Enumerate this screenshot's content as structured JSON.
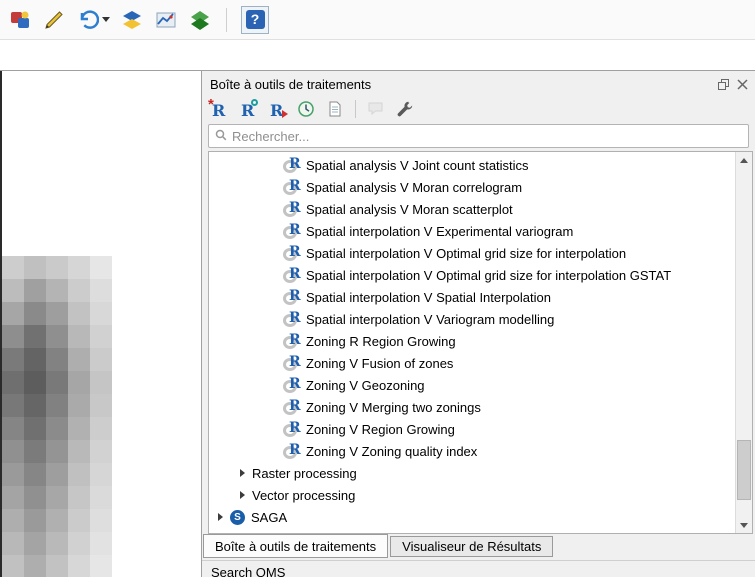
{
  "main_toolbar": {
    "icons": [
      "processing-icon",
      "pen-digitize-icon",
      "undo-icon",
      "undo-dropdown-arrow-icon",
      "saga-layers-icon",
      "profile-map-icon",
      "grass-icon",
      "help-icon"
    ]
  },
  "panel": {
    "title": "Boîte à outils de traitements",
    "titlebar_icons": [
      "float-panel-icon",
      "close-panel-icon"
    ],
    "toolbar_icons": [
      "new-r-script-icon",
      "open-r-script-icon",
      "save-r-script-icon",
      "history-icon",
      "log-icon",
      "comment-icon",
      "options-icon"
    ],
    "search": {
      "placeholder": "Rechercher...",
      "icon": "search-icon",
      "value": ""
    },
    "tree": {
      "script_icon": "r-logo-icon",
      "scripts": [
        "Spatial analysis V Joint count statistics",
        "Spatial analysis V Moran correlogram",
        "Spatial analysis V Moran scatterplot",
        "Spatial interpolation V Experimental variogram",
        "Spatial interpolation V Optimal grid size for interpolation",
        "Spatial interpolation V Optimal grid size for interpolation GSTAT",
        "Spatial interpolation V Spatial Interpolation",
        "Spatial interpolation V Variogram modelling",
        "Zoning R Region Growing",
        "Zoning V Fusion of zones",
        "Zoning V Geozoning",
        "Zoning V Merging two zonings",
        "Zoning V Region Growing",
        "Zoning V Zoning quality index"
      ],
      "groups": [
        {
          "label": "Raster processing",
          "depth": 1,
          "icon": ""
        },
        {
          "label": "Vector processing",
          "depth": 1,
          "icon": ""
        },
        {
          "label": "SAGA",
          "depth": 0,
          "icon": "saga"
        }
      ]
    },
    "tabs": [
      {
        "label": "Boîte à outils de traitements",
        "active": true
      },
      {
        "label": "Visualiseur de Résultats",
        "active": false
      }
    ]
  },
  "bottom_panel": {
    "title": "Search QMS"
  },
  "colors": {
    "accent_blue": "#1d5fae",
    "panel_bg": "#f0f0f0",
    "saga_blue": "#1a5da8",
    "r_ring_gray": "#c3c3c3"
  },
  "map_preview": {
    "pixels": [
      [
        "#cdcdcd",
        "#c0c0c0",
        "#cacaca",
        "#d6d6d6",
        "#e6e6e6"
      ],
      [
        "#bcbcbc",
        "#a0a0a0",
        "#b4b4b4",
        "#cccccc",
        "#dddddd"
      ],
      [
        "#a6a6a6",
        "#8a8a8a",
        "#9e9e9e",
        "#c2c2c2",
        "#d8d8d8"
      ],
      [
        "#8e8e8e",
        "#717171",
        "#8f8f8f",
        "#b8b8b8",
        "#d1d1d1"
      ],
      [
        "#7a7a7a",
        "#646464",
        "#828282",
        "#aeaeae",
        "#cbcbcb"
      ],
      [
        "#6f6f6f",
        "#5d5d5d",
        "#797979",
        "#a6a6a6",
        "#c5c5c5"
      ],
      [
        "#787878",
        "#666666",
        "#818181",
        "#aaaaaa",
        "#c8c8c8"
      ],
      [
        "#858585",
        "#707070",
        "#8b8b8b",
        "#b1b1b1",
        "#cdcdcd"
      ],
      [
        "#909090",
        "#7b7b7b",
        "#949494",
        "#b9b9b9",
        "#d2d2d2"
      ],
      [
        "#9a9a9a",
        "#868686",
        "#9e9e9e",
        "#c0c0c0",
        "#d6d6d6"
      ],
      [
        "#a4a4a4",
        "#909090",
        "#a7a7a7",
        "#c6c6c6",
        "#dadada"
      ],
      [
        "#aeaeae",
        "#9a9a9a",
        "#b0b0b0",
        "#cbcbcb",
        "#dedede"
      ],
      [
        "#b8b8b8",
        "#a4a4a4",
        "#b9b9b9",
        "#d1d1d1",
        "#e2e2e2"
      ],
      [
        "#c1c1c1",
        "#aeaeae",
        "#c2c2c2",
        "#d7d7d7",
        "#e6e6e6"
      ]
    ]
  }
}
